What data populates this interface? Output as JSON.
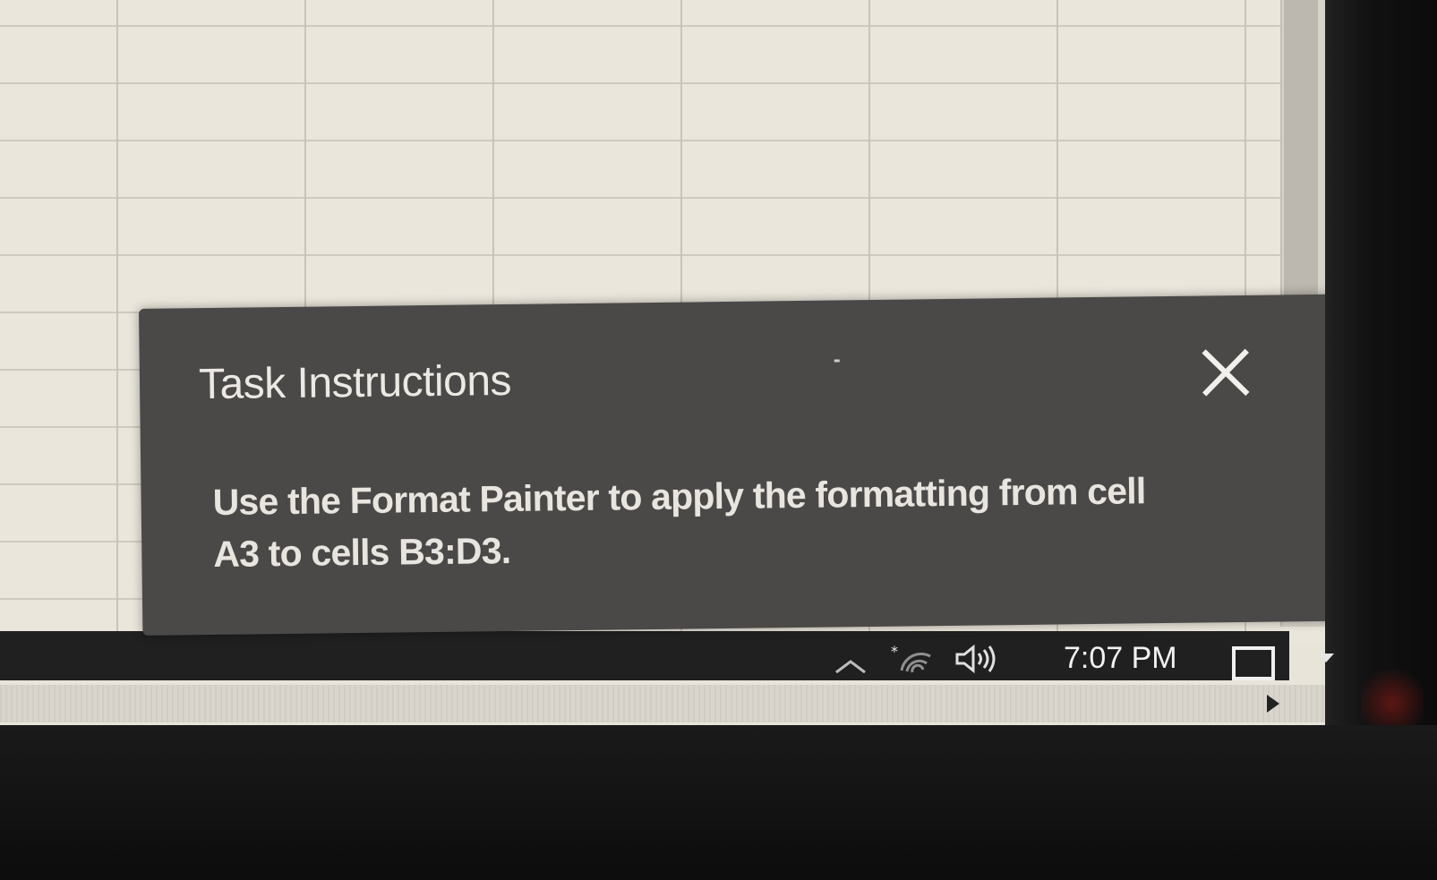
{
  "dialog": {
    "title": "Task Instructions",
    "close_icon": "close-icon",
    "minimize_icon": "minimize-icon",
    "body_line1": "Use the Format Painter to apply the formatting from cell",
    "body_line2": "A3 to cells B3:D3."
  },
  "taskbar": {
    "clock": "7:07 PM",
    "icons": [
      "chevron-up-icon",
      "wifi-icon",
      "speaker-icon",
      "action-center-icon"
    ]
  },
  "colors": {
    "dialog_bg": "#4b4947",
    "dialog_text": "#ece9e4",
    "taskbar_bg": "#202020",
    "sheet_bg": "#ebe6dc"
  }
}
